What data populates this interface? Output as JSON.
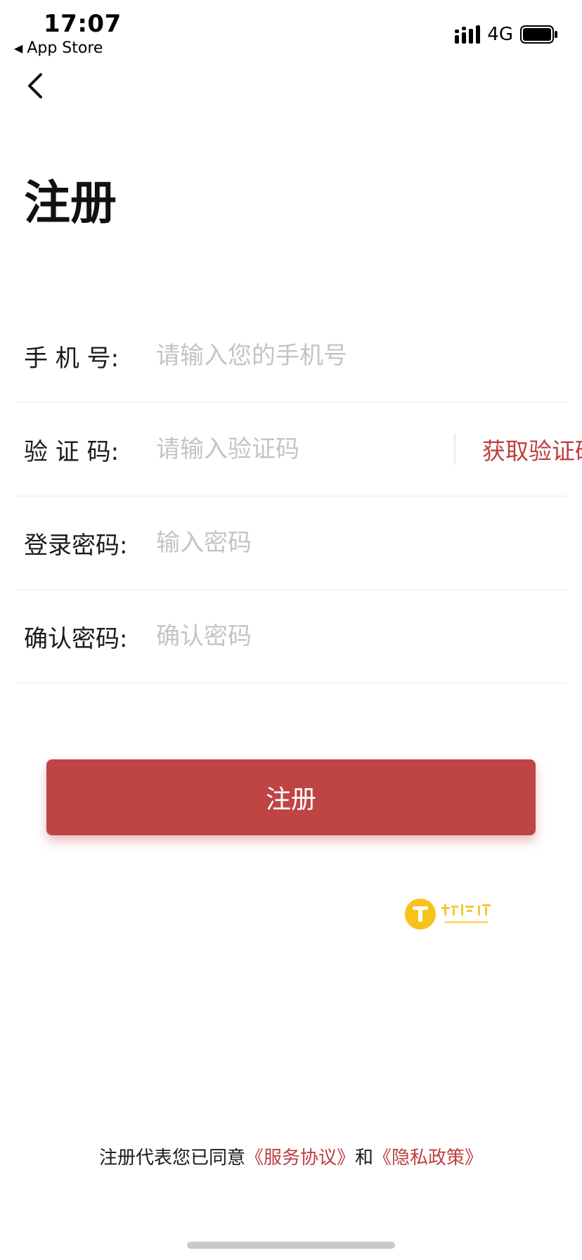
{
  "status_bar": {
    "time": "17:07",
    "back_app": "App Store",
    "network": "4G"
  },
  "page": {
    "title": "注册"
  },
  "form": {
    "phone": {
      "label": "手 机 号:",
      "placeholder": "请输入您的手机号"
    },
    "code": {
      "label": "验 证 码:",
      "placeholder": "请输入验证码",
      "get_code_label": "获取验证码"
    },
    "password": {
      "label": "登录密码:",
      "placeholder": "输入密码"
    },
    "confirm_password": {
      "label": "确认密码:",
      "placeholder": "确认密码"
    }
  },
  "register_button": {
    "label": "注册"
  },
  "watermark": {
    "name": "桃源地",
    "sub": "taoyuandi",
    "icon": "t-logo-icon"
  },
  "agreement": {
    "prefix": "注册代表您已同意",
    "service_link": "《服务协议》",
    "conjunction": "和",
    "privacy_link": "《隐私政策》"
  },
  "colors": {
    "accent": "#bf4444",
    "link": "#bd3f3f",
    "placeholder": "#c4c4c4",
    "divider": "#ebebeb",
    "logo_yellow": "#f7c31b"
  }
}
